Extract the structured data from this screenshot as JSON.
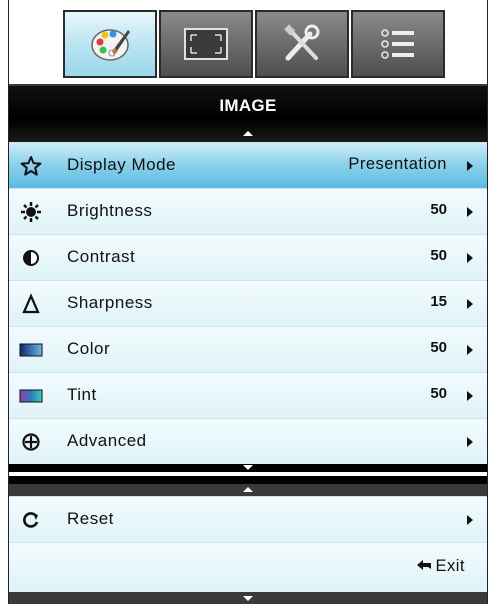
{
  "tabs": [
    {
      "name": "image-tab",
      "icon": "palette-icon",
      "active": true
    },
    {
      "name": "display-tab",
      "icon": "screen-resize-icon",
      "active": false
    },
    {
      "name": "setup-tab",
      "icon": "tools-icon",
      "active": false
    },
    {
      "name": "options-tab",
      "icon": "list-icon",
      "active": false
    }
  ],
  "menu": {
    "title": "IMAGE",
    "items": [
      {
        "label": "Display Mode",
        "value": "Presentation",
        "icon": "star-icon",
        "selected": true
      },
      {
        "label": "Brightness",
        "value": "50",
        "icon": "sun-icon"
      },
      {
        "label": "Contrast",
        "value": "50",
        "icon": "contrast-icon"
      },
      {
        "label": "Sharpness",
        "value": "15",
        "icon": "sharpness-icon"
      },
      {
        "label": "Color",
        "value": "50",
        "icon": "color-icon"
      },
      {
        "label": "Tint",
        "value": "50",
        "icon": "tint-icon"
      },
      {
        "label": "Advanced",
        "value": "",
        "icon": "advanced-icon"
      }
    ],
    "reset": {
      "label": "Reset",
      "icon": "reset-icon"
    },
    "exit": {
      "label": "Exit",
      "icon": "back-arrow-icon"
    }
  },
  "colors": {
    "accent": "#5cb9e0",
    "row_bg": "#e6f6fa",
    "title_bg": "#000000"
  }
}
